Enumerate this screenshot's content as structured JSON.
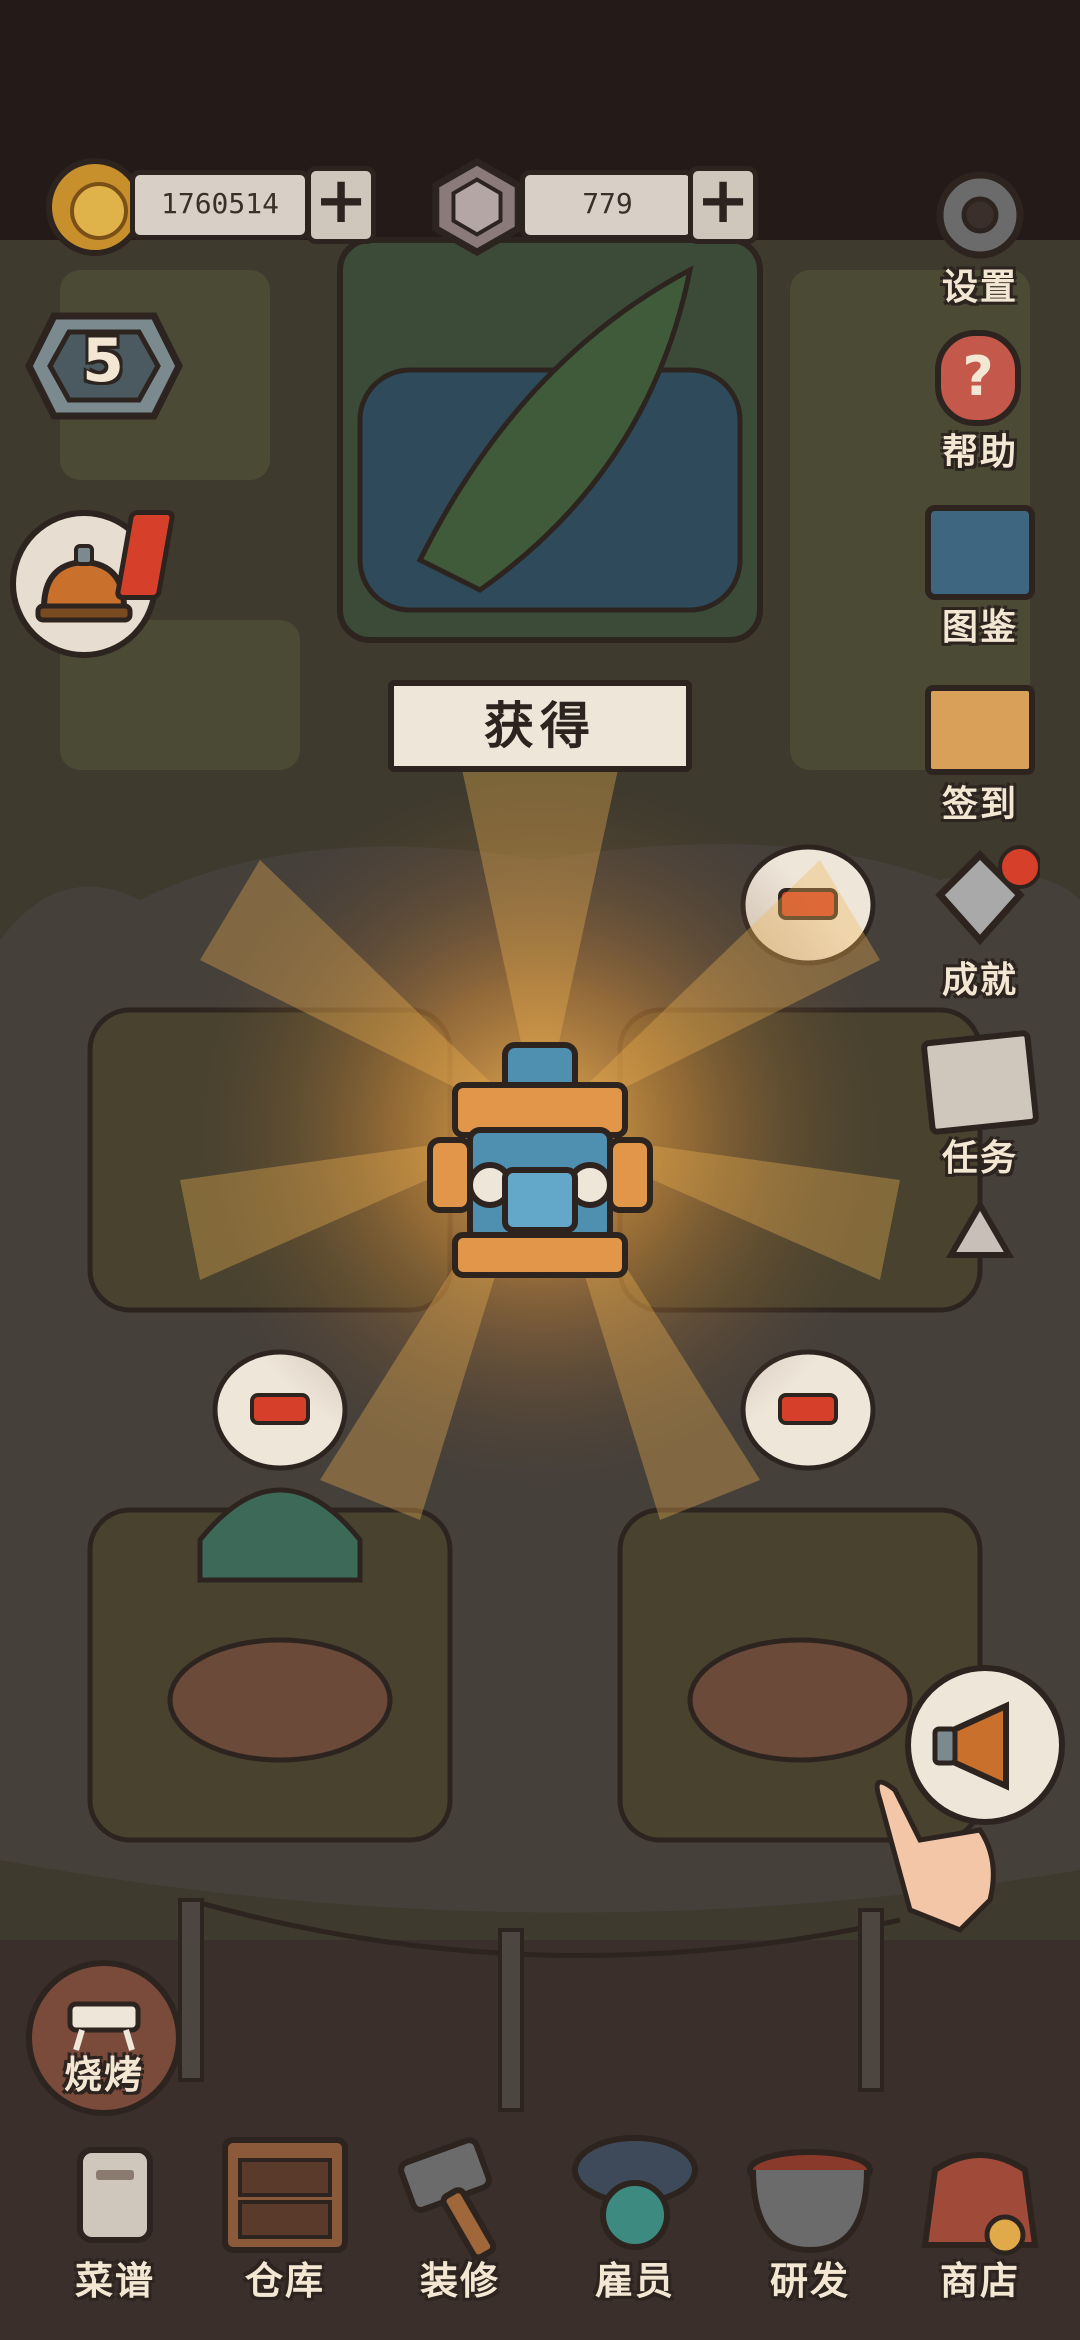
{
  "currency": {
    "coins": "1760514",
    "gems": "779"
  },
  "level": "5",
  "banner": {
    "title": "获得"
  },
  "side_menu": {
    "settings": "设置",
    "help": "帮助",
    "collection": "图鉴",
    "checkin": "签到",
    "achievements": "成就",
    "tasks": "任务"
  },
  "bbq_button": "烧烤",
  "bottom_nav": [
    {
      "label": "菜谱",
      "icon": "recipe-scroll-icon"
    },
    {
      "label": "仓库",
      "icon": "warehouse-cabinet-icon"
    },
    {
      "label": "装修",
      "icon": "hammer-icon"
    },
    {
      "label": "雇员",
      "icon": "employee-cap-icon"
    },
    {
      "label": "研发",
      "icon": "research-pot-icon"
    },
    {
      "label": "商店",
      "icon": "shop-bag-icon"
    }
  ],
  "colors": {
    "background": "#3a2f2a",
    "grass": "#3f3b2e",
    "outline": "#2d2420",
    "label_text": "#f3e7d4",
    "accent_red": "#d6402a",
    "gold": "#e0a94a",
    "glow": "#f2b552"
  }
}
